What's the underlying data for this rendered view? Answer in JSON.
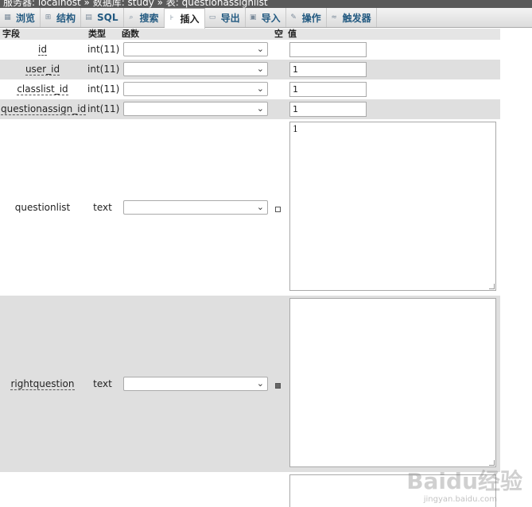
{
  "breadcrumb": "服务器: localhost » 数据库: study » 表: questionassignlist",
  "tabs": [
    {
      "label": "浏览",
      "icon": "browse-icon"
    },
    {
      "label": "结构",
      "icon": "structure-icon"
    },
    {
      "label": "SQL",
      "icon": "sql-icon"
    },
    {
      "label": "搜索",
      "icon": "search-icon"
    },
    {
      "label": "插入",
      "icon": "insert-icon"
    },
    {
      "label": "导出",
      "icon": "export-icon"
    },
    {
      "label": "导入",
      "icon": "import-icon"
    },
    {
      "label": "操作",
      "icon": "operations-icon"
    },
    {
      "label": "触发器",
      "icon": "triggers-icon"
    }
  ],
  "header": {
    "field": "字段",
    "type": "类型",
    "function": "函数",
    "null": "空",
    "value": "值"
  },
  "fields": [
    {
      "name": "id",
      "type": "int(11)",
      "value": ""
    },
    {
      "name": "user_id",
      "type": "int(11)",
      "value": "1"
    },
    {
      "name": "classlist_id",
      "type": "int(11)",
      "value": "1"
    },
    {
      "name": "questionassign_id",
      "type": "int(11)",
      "value": "1"
    },
    {
      "name": "questionlist",
      "type": "text",
      "value": "1",
      "null_checked": false
    },
    {
      "name": "rightquestion",
      "type": "text",
      "value": "",
      "null_checked": true
    }
  ],
  "watermark": {
    "logo": "Baidu经验",
    "url": "jingyan.baidu.com"
  }
}
